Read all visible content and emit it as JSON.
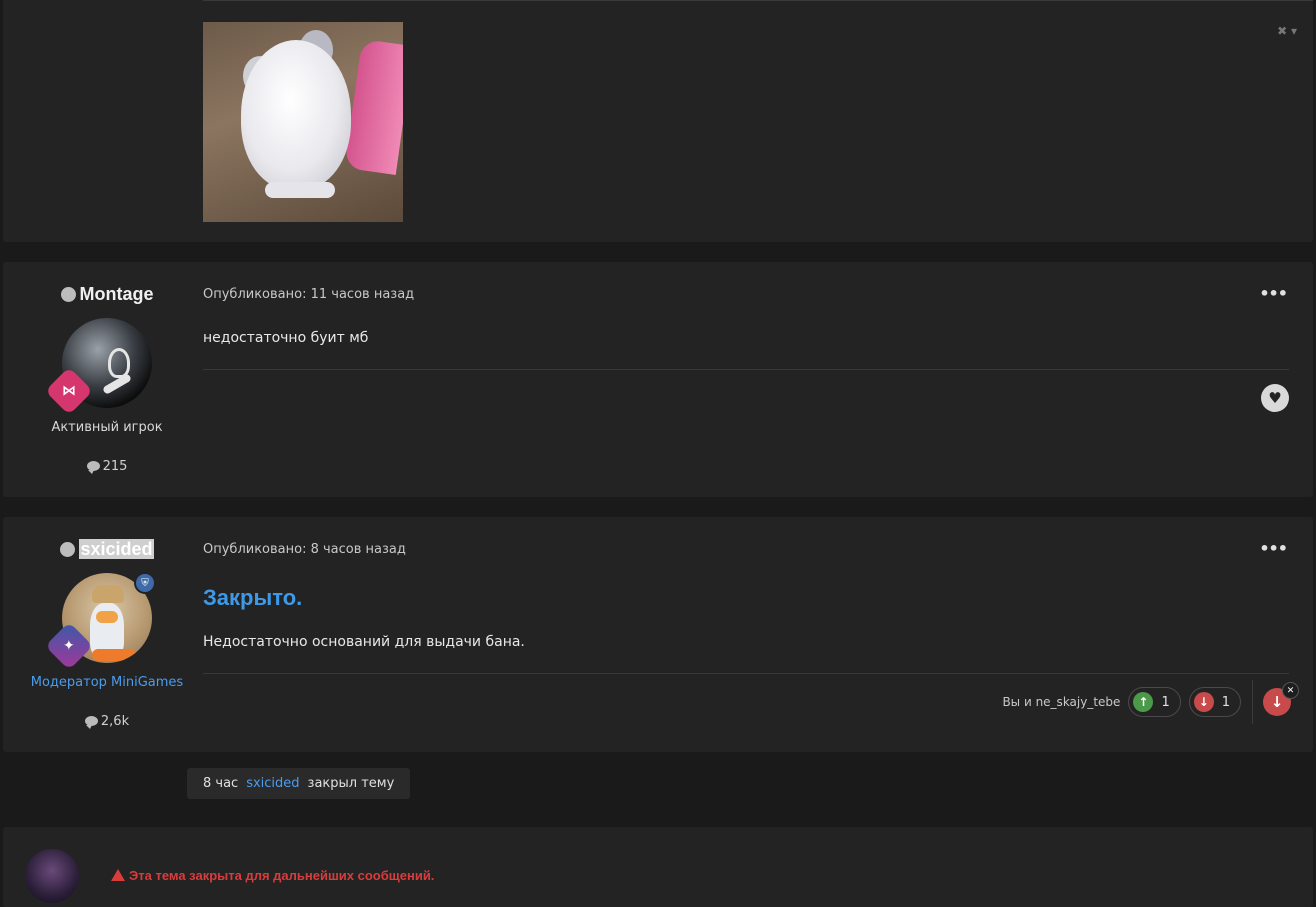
{
  "post_top": {
    "tools_icon": "close-caret-icon"
  },
  "post_montage": {
    "author": "Montage",
    "rank_icon": "share-icon",
    "title": "Активный игрок",
    "post_count": "215",
    "meta": "Опубликовано: 11 часов назад",
    "content": "недостаточно буит мб",
    "like_icon": "heart-icon"
  },
  "post_sxicided": {
    "author": "sxicided",
    "rank_icon": "confetti-icon",
    "mod_icon": "shield-icon",
    "title": "Модератор MiniGames",
    "post_count": "2,6k",
    "meta": "Опубликовано: 8 часов назад",
    "heading": "Закрыто.",
    "content": "Недостаточно оснований для выдачи бана.",
    "reactions": {
      "who": "Вы и ne_skajy_tebe",
      "upvotes": "1",
      "downvotes": "1"
    }
  },
  "event": {
    "time": "8 час",
    "user": "sxicided",
    "action": "закрыл тему"
  },
  "reply": {
    "locked_message": "Эта тема закрыта для дальнейших сообщений."
  },
  "colors": {
    "accent": "#3d9ae8",
    "error": "#d93c3c",
    "upvote": "#4a9a4a",
    "downvote": "#c84a4a"
  }
}
